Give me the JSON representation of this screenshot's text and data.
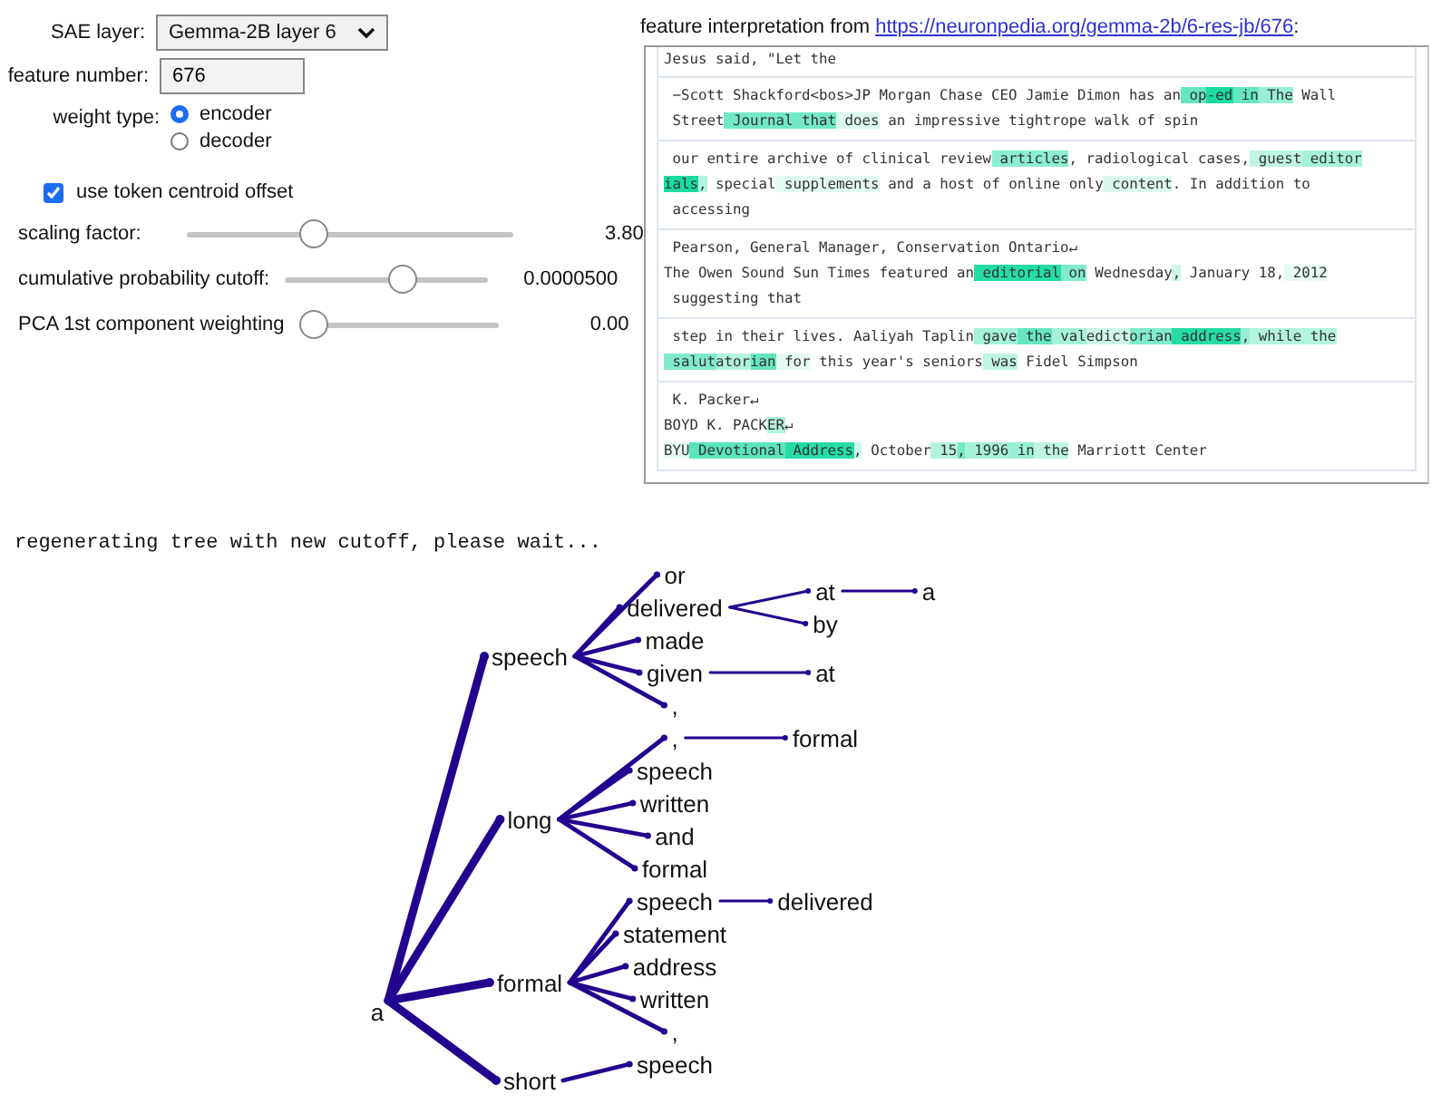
{
  "controls": {
    "sae_layer": {
      "label": "SAE layer:",
      "value": "Gemma-2B layer 6"
    },
    "feature_number": {
      "label": "feature number:",
      "value": "676"
    },
    "weight_type": {
      "label": "weight type:",
      "options": [
        {
          "label": "encoder",
          "selected": true
        },
        {
          "label": "decoder",
          "selected": false
        }
      ]
    },
    "centroid_offset": {
      "label": "use token centroid offset",
      "checked": true
    },
    "sliders": [
      {
        "label": "scaling factor:",
        "level": 0.38,
        "reading": "3.80"
      },
      {
        "label": "cumulative probability cutoff:",
        "level": 0.6,
        "reading": "0.0000500"
      },
      {
        "label": "PCA 1st component weighting",
        "level": 0,
        "reading": "0.00"
      }
    ]
  },
  "interpretation": {
    "heading": "feature interpretation from",
    "link": "https://neuronpedia.org/gemma-2b/6-res-jb/676",
    "colon": ":",
    "snippets": [
      {
        "lines": [
          [
            {
              "text": "Jesus said, \"Let the"
            }
          ]
        ]
      },
      {
        "lines": [
          [
            {
              "text": " −Scott Shackford<bos>JP Morgan Chase CEO Jamie Dimon has an"
            },
            {
              "text": " op",
              "color": "#66e6c0"
            },
            {
              "text": "-ed",
              "color": "#1adaa1"
            },
            {
              "text": " in",
              "color": "#66e6c0"
            },
            {
              "text": " The",
              "color": "#99efd5"
            },
            {
              "text": " Wall"
            }
          ],
          [
            {
              "text": " Street"
            },
            {
              "text": " Journal",
              "color": "#73e8c5"
            },
            {
              "text": " that",
              "color": "#73e8c5"
            },
            {
              "text": " does",
              "color": "#d9f9ef"
            },
            {
              "text": " an impressive tightrope walk of spin"
            }
          ]
        ]
      },
      {
        "lines": [
          [
            {
              "text": " our entire archive of clinical review"
            },
            {
              "text": " articles",
              "color": "#8cedd0"
            },
            {
              "text": ", radiological cases,"
            },
            {
              "text": " guest",
              "color": "#bff5e5"
            },
            {
              "text": " editor",
              "color": "#a6f1da"
            }
          ],
          [
            {
              "text": "ials",
              "color": "#1adaa1"
            },
            {
              "text": ",",
              "color": "#b3f3e0"
            },
            {
              "text": " special"
            },
            {
              "text": " supplements",
              "color": "#e0faf2"
            },
            {
              "text": " and a host of online only"
            },
            {
              "text": " content",
              "color": "#d9f9ef"
            },
            {
              "text": ". In addition to"
            }
          ],
          [
            {
              "text": " accessing"
            }
          ]
        ]
      },
      {
        "lines": [
          [
            {
              "text": " Pearson, General Manager, Conservation Ontario↵"
            }
          ],
          [
            {
              "text": "The Owen Sound Sun Times featured an"
            },
            {
              "text": " editorial",
              "color": "#26dca6"
            },
            {
              "text": " on",
              "color": "#80ebcb"
            },
            {
              "text": " Wednesday"
            },
            {
              "text": ",",
              "color": "#ccf7ea"
            },
            {
              "text": " January 18,"
            },
            {
              "text": " 2012",
              "color": "#e6fbf4"
            }
          ],
          [
            {
              "text": " suggesting that"
            }
          ]
        ]
      },
      {
        "lines": [
          [
            {
              "text": " step in their lives. Aaliyah Taplin"
            },
            {
              "text": " gave",
              "color": "#a6f1da"
            },
            {
              "text": " the",
              "color": "#66e6c0"
            },
            {
              "text": " val",
              "color": "#a6f1da"
            },
            {
              "text": "edict",
              "color": "#ccf7ea"
            },
            {
              "text": "orian",
              "color": "#80ebcb"
            },
            {
              "text": " address",
              "color": "#26dca6"
            },
            {
              "text": ",",
              "color": "#99efd5"
            },
            {
              "text": " while the",
              "color": "#b3f3e0"
            }
          ],
          [
            {
              "text": " salut",
              "color": "#80ebcb"
            },
            {
              "text": "ator",
              "color": "#b3f3e0"
            },
            {
              "text": "ian",
              "color": "#66e6c0"
            },
            {
              "text": " for",
              "color": "#e6fbf4"
            },
            {
              "text": " this year's seniors"
            },
            {
              "text": " was",
              "color": "#bff5e5"
            },
            {
              "text": " Fidel Simpson"
            }
          ]
        ]
      },
      {
        "lines": [
          [
            {
              "text": " K. Packer↵"
            }
          ],
          [
            {
              "text": "BOYD K. PACK"
            },
            {
              "text": "ER",
              "color": "#b3f3e0"
            },
            {
              "text": "↵"
            }
          ],
          [
            {
              "text": "BYU",
              "color": "#e6fbf4"
            },
            {
              "text": " Devotional",
              "color": "#59e4bb"
            },
            {
              "text": " Address",
              "color": "#26dca6"
            },
            {
              "text": ",",
              "color": "#ccf7ea"
            },
            {
              "text": " October"
            },
            {
              "text": " 15",
              "color": "#b3f3e0"
            },
            {
              "text": ",",
              "color": "#73e8c5"
            },
            {
              "text": " 1996",
              "color": "#a6f1da"
            },
            {
              "text": " in",
              "color": "#99efd5"
            },
            {
              "text": " the",
              "color": "#bff5e5"
            },
            {
              "text": " Marriott Center"
            }
          ]
        ]
      }
    ]
  },
  "status": "regenerating tree with new cutoff, please wait...",
  "tree": {
    "word": "a",
    "children": [
      {
        "word": "speech",
        "children": [
          {
            "word": "or"
          },
          {
            "word": "delivered",
            "children": [
              {
                "word": "at",
                "children": [
                  {
                    "word": "a"
                  }
                ]
              },
              {
                "word": "by"
              }
            ]
          },
          {
            "word": "made"
          },
          {
            "word": "given",
            "children": [
              {
                "word": "at"
              }
            ]
          },
          {
            "word": ","
          }
        ]
      },
      {
        "word": "long",
        "children": [
          {
            "word": ",",
            "children": [
              {
                "word": "formal"
              }
            ]
          },
          {
            "word": "speech"
          },
          {
            "word": "written"
          },
          {
            "word": "and"
          },
          {
            "word": "formal"
          }
        ]
      },
      {
        "word": "formal",
        "children": [
          {
            "word": "speech",
            "children": [
              {
                "word": "delivered"
              }
            ]
          },
          {
            "word": "statement"
          },
          {
            "word": "address"
          },
          {
            "word": "written"
          },
          {
            "word": ","
          }
        ]
      },
      {
        "word": "short",
        "children": [
          {
            "word": "speech"
          }
        ]
      }
    ]
  }
}
